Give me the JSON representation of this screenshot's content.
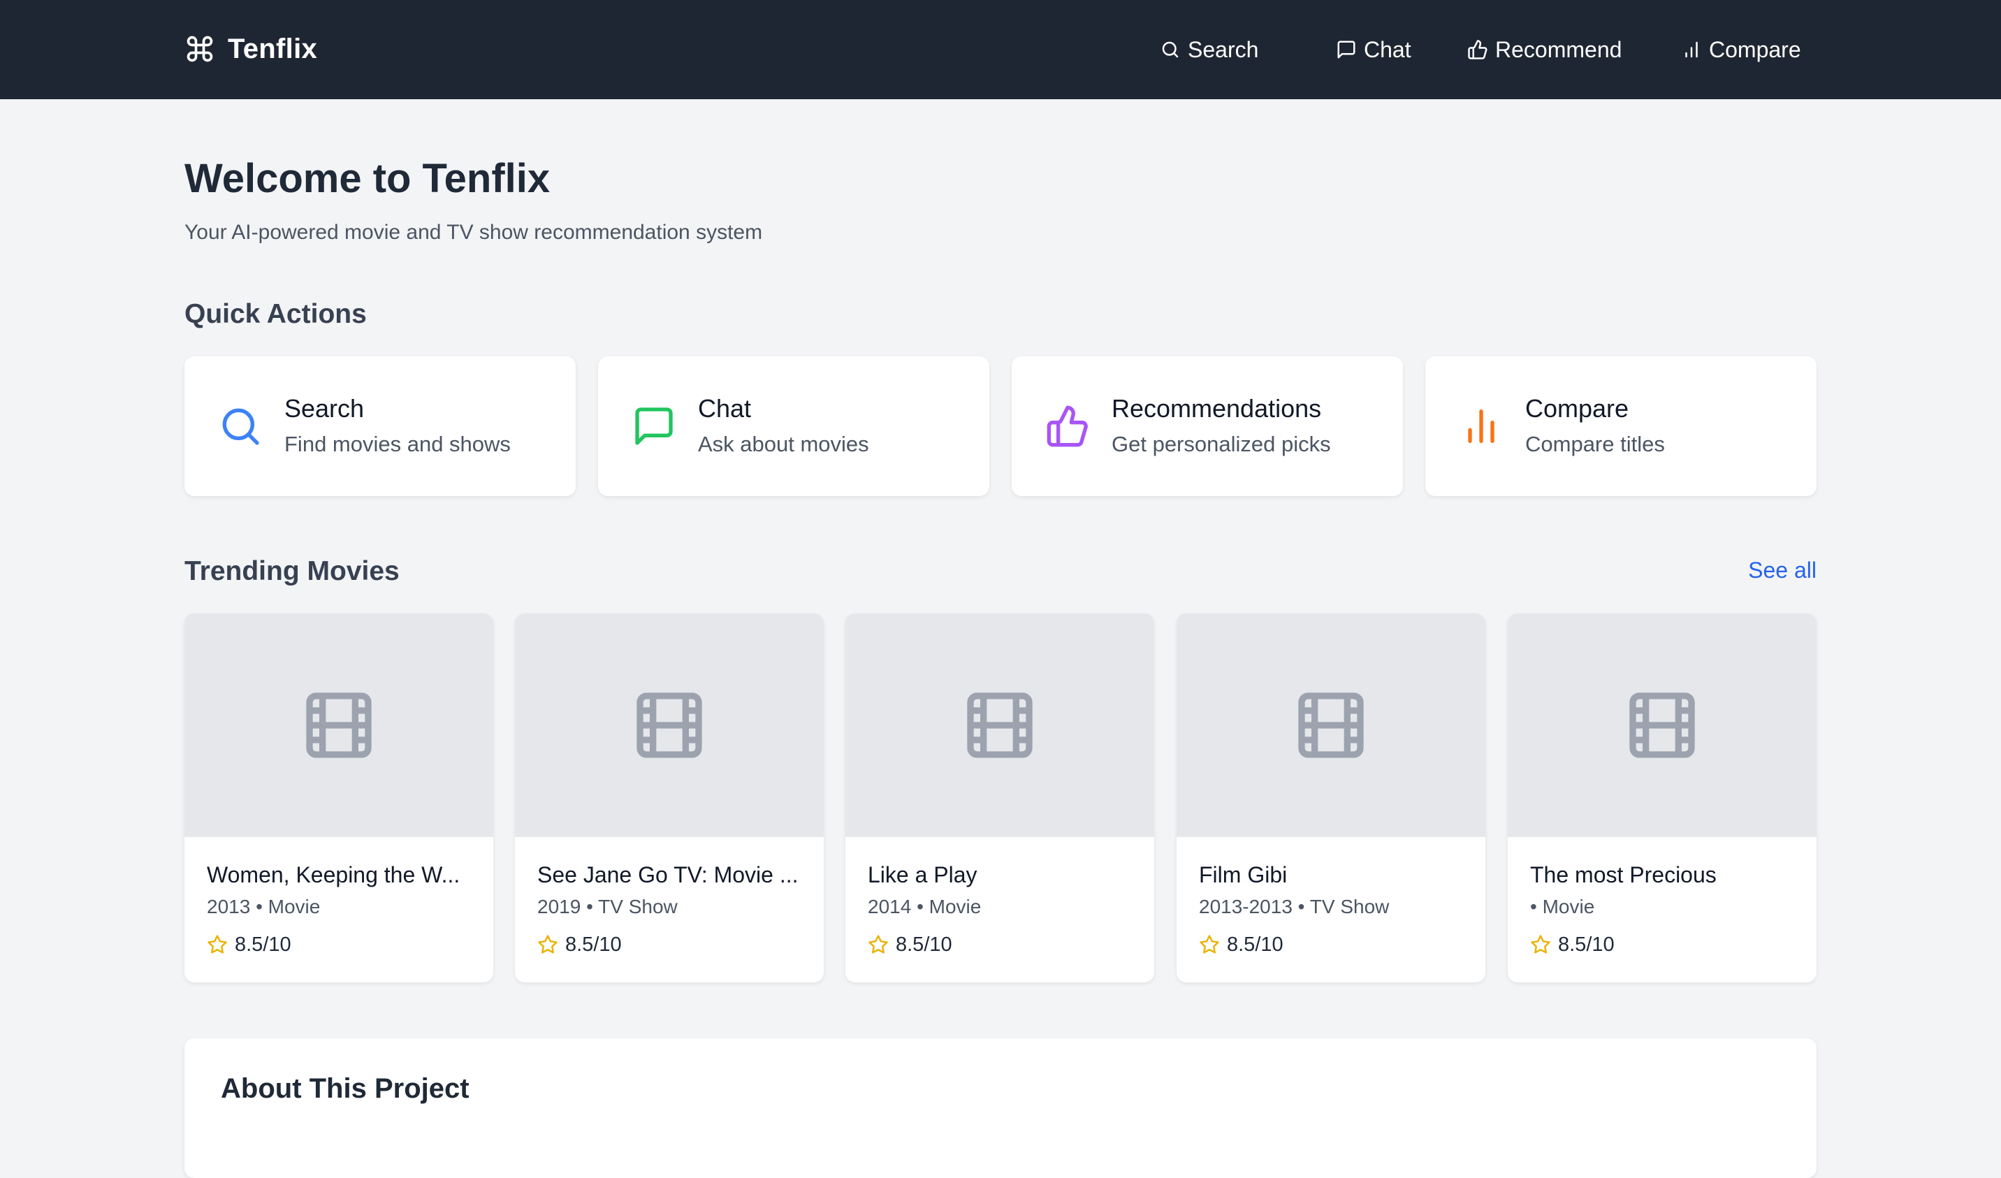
{
  "app": {
    "name": "Tenflix",
    "logo_icon": "command-icon"
  },
  "nav": {
    "search": "Search",
    "chat": "Chat",
    "recommend": "Recommend",
    "compare": "Compare"
  },
  "header": {
    "title": "Welcome to Tenflix",
    "subtitle": "Your AI-powered movie and TV show recommendation system"
  },
  "quick_actions": {
    "title": "Quick Actions",
    "items": [
      {
        "label": "Search",
        "description": "Find movies and shows",
        "icon": "search-icon",
        "color": "#3b82f6"
      },
      {
        "label": "Chat",
        "description": "Ask about movies",
        "icon": "chat-icon",
        "color": "#22c55e"
      },
      {
        "label": "Recommendations",
        "description": "Get personalized picks",
        "icon": "thumbs-up-icon",
        "color": "#a855f7"
      },
      {
        "label": "Compare",
        "description": "Compare titles",
        "icon": "bar-chart-icon",
        "color": "#f97316"
      }
    ]
  },
  "trending": {
    "title": "Trending Movies",
    "see_all": "See all",
    "items": [
      {
        "title": "Women, Keeping the W...",
        "meta": "2013 • Movie",
        "rating": "8.5/10"
      },
      {
        "title": "See Jane Go TV: Movie ...",
        "meta": "2019 • TV Show",
        "rating": "8.5/10"
      },
      {
        "title": "Like a Play",
        "meta": "2014 • Movie",
        "rating": "8.5/10"
      },
      {
        "title": "Film Gibi",
        "meta": "2013-2013 • TV Show",
        "rating": "8.5/10"
      },
      {
        "title": "The most Precious",
        "meta": " • Movie",
        "rating": "8.5/10"
      }
    ]
  },
  "about": {
    "title": "About This Project"
  },
  "colors": {
    "nav_bg": "#1f2633",
    "page_bg": "#f3f4f6",
    "link": "#2563eb",
    "star": "#eab308",
    "poster_bg": "#e5e7eb",
    "poster_icon": "#9ca3af"
  }
}
